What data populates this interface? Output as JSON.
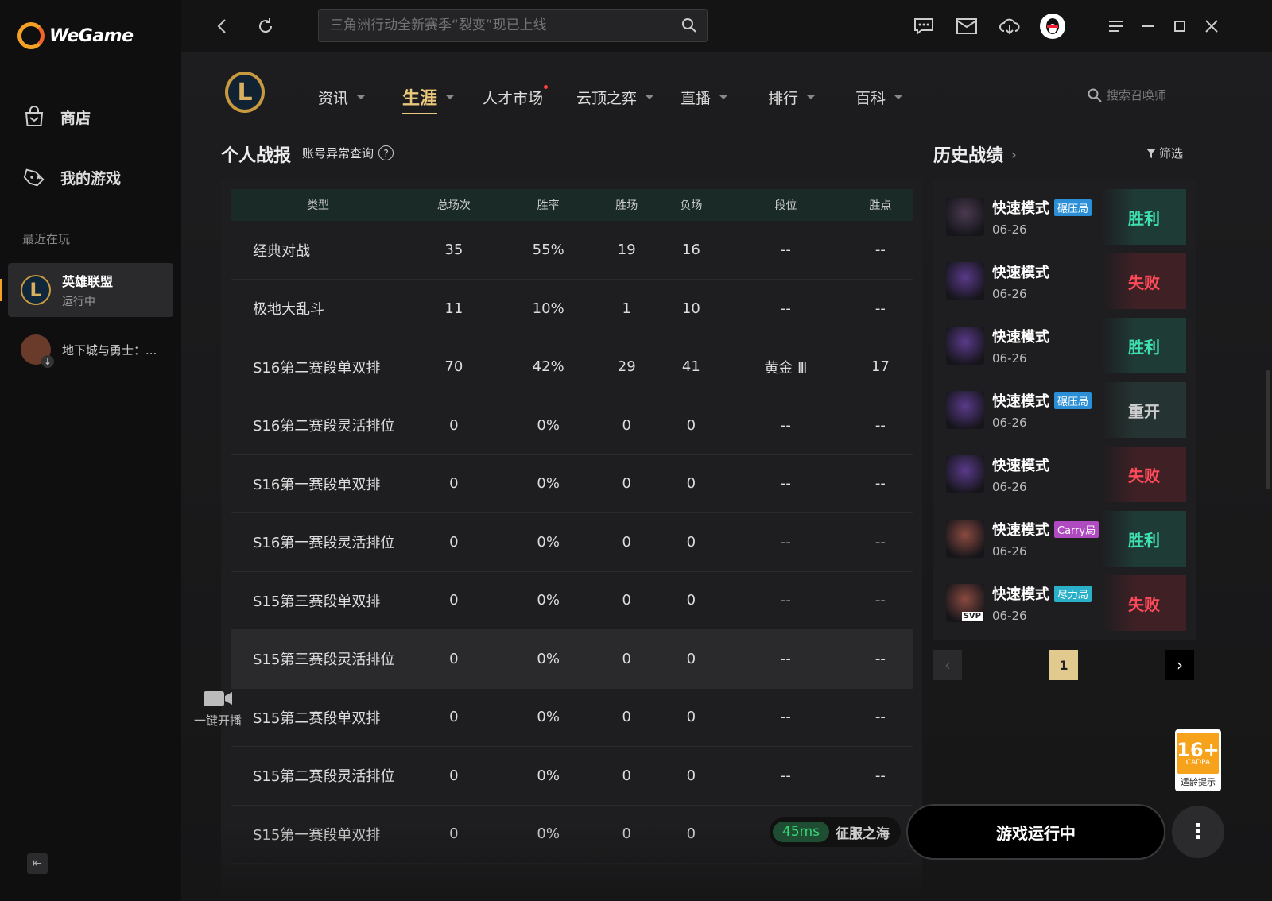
{
  "sidebar": {
    "brand": "WeGame",
    "nav": [
      {
        "label": "商店",
        "icon": "shop-bag-icon"
      },
      {
        "label": "我的游戏",
        "icon": "gamepad-icon"
      }
    ],
    "recent_label": "最近在玩",
    "games": [
      {
        "name": "英雄联盟",
        "status": "运行中"
      },
      {
        "name": "地下城与勇士：..."
      }
    ]
  },
  "topbar": {
    "search_placeholder": "三角洲行动全新赛季“裂变”现已上线"
  },
  "game_nav": {
    "items": [
      {
        "label": "资讯",
        "caret": true
      },
      {
        "label": "生涯",
        "caret": true,
        "active": true
      },
      {
        "label": "人才市场",
        "dot": true
      },
      {
        "label": "云顶之弈",
        "caret": true
      },
      {
        "label": "直播",
        "caret": true
      },
      {
        "label": "排行",
        "caret": true
      },
      {
        "label": "百科",
        "caret": true
      }
    ],
    "summoner_search_placeholder": "搜索召唤师"
  },
  "stats": {
    "title": "个人战报",
    "account_link": "账号异常查询",
    "help": "?",
    "headers": [
      "类型",
      "总场次",
      "胜率",
      "胜场",
      "负场",
      "段位",
      "胜点"
    ],
    "rows": [
      [
        "经典对战",
        "35",
        "55%",
        "19",
        "16",
        "--",
        "--"
      ],
      [
        "极地大乱斗",
        "11",
        "10%",
        "1",
        "10",
        "--",
        "--"
      ],
      [
        "S16第二赛段单双排",
        "70",
        "42%",
        "29",
        "41",
        "黄金 Ⅲ",
        "17"
      ],
      [
        "S16第二赛段灵活排位",
        "0",
        "0%",
        "0",
        "0",
        "--",
        "--"
      ],
      [
        "S16第一赛段单双排",
        "0",
        "0%",
        "0",
        "0",
        "--",
        "--"
      ],
      [
        "S16第一赛段灵活排位",
        "0",
        "0%",
        "0",
        "0",
        "--",
        "--"
      ],
      [
        "S15第三赛段单双排",
        "0",
        "0%",
        "0",
        "0",
        "--",
        "--"
      ],
      [
        "S15第三赛段灵活排位",
        "0",
        "0%",
        "0",
        "0",
        "--",
        "--"
      ],
      [
        "S15第二赛段单双排",
        "0",
        "0%",
        "0",
        "0",
        "--",
        "--"
      ],
      [
        "S15第二赛段灵活排位",
        "0",
        "0%",
        "0",
        "0",
        "--",
        "--"
      ],
      [
        "S15第一赛段单双排",
        "0",
        "0%",
        "0",
        "0",
        "--",
        "--"
      ]
    ],
    "highlight_row": 7
  },
  "stream_button": "一键开播",
  "history": {
    "title": "历史战绩",
    "arrow": "›",
    "filter": "筛选",
    "matches": [
      {
        "mode": "快速模式",
        "tag": "碾压局",
        "tag_color": "#2a8fd6",
        "date": "06-26",
        "result": "胜利",
        "kind": "win",
        "avatar": "#4a3a50"
      },
      {
        "mode": "快速模式",
        "tag": "",
        "tag_color": "",
        "date": "06-26",
        "result": "失败",
        "kind": "lose",
        "avatar": "#5a3a8a"
      },
      {
        "mode": "快速模式",
        "tag": "",
        "tag_color": "",
        "date": "06-26",
        "result": "胜利",
        "kind": "win",
        "avatar": "#5a3a8a"
      },
      {
        "mode": "快速模式",
        "tag": "碾压局",
        "tag_color": "#2a8fd6",
        "date": "06-26",
        "result": "重开",
        "kind": "redo",
        "avatar": "#5a3a8a"
      },
      {
        "mode": "快速模式",
        "tag": "",
        "tag_color": "",
        "date": "06-26",
        "result": "失败",
        "kind": "lose",
        "avatar": "#5a3a8a"
      },
      {
        "mode": "快速模式",
        "tag": "Carry局",
        "tag_color": "#b04ac0",
        "date": "06-26",
        "result": "胜利",
        "kind": "win",
        "avatar": "#8a4a40"
      },
      {
        "mode": "快速模式",
        "tag": "尽力局",
        "tag_color": "#2ab0c8",
        "date": "06-26",
        "result": "失败",
        "kind": "lose",
        "avatar": "#8a4a40",
        "svp": "SVP"
      }
    ],
    "page": "1"
  },
  "footer": {
    "ping": "45ms",
    "server": "征服之海",
    "run_button": "游戏运行中",
    "age_rating": "16+",
    "age_org": "CADPA",
    "age_hint": "适龄提示"
  }
}
